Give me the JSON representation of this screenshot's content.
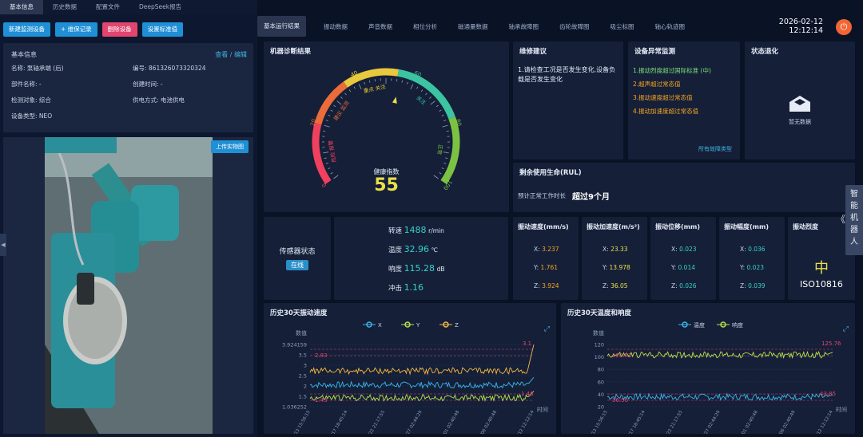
{
  "nav": {
    "tabs": [
      "基本信息",
      "历史数据",
      "配置文件",
      "DeepSeek报告"
    ]
  },
  "actions": {
    "new": "新建监测设备",
    "repair": "+ 维保记录",
    "delete": "删除设备",
    "standard": "设置标准值"
  },
  "info": {
    "title": "基本信息",
    "edit": "查看 / 编辑",
    "name": "名称:  泵轴承端 (后)",
    "code": "编号:  861326073320324",
    "part": "部件名称:  -",
    "created": "创建时间:  -",
    "object": "检测对象:  综合",
    "power": "供电方式:  电池供电",
    "type": "设备类型:  NEO"
  },
  "photo": {
    "upload": "上传实物图"
  },
  "subtabs": [
    "基本运行结果",
    "振动数据",
    "声音数据",
    "相位分析",
    "磁通量数据",
    "轴承故障图",
    "齿轮故障图",
    "吸尘标图",
    "轴心轨迹图"
  ],
  "datetime": {
    "date": "2026-02-12",
    "time": "12:12:14"
  },
  "diag": {
    "title": "机器诊断结果",
    "health_label": "健康指数",
    "health": 55,
    "health_fraction": 0.55,
    "ticks": [
      "0",
      "20",
      "40",
      "60",
      "80",
      "100"
    ],
    "zones": [
      "危险 报警",
      "建议 监测",
      "重点 关注",
      "关注",
      "正常"
    ]
  },
  "maint": {
    "title": "维修建议",
    "text": "1.请检查工况是否发生变化,设备负载是否发生变化"
  },
  "anomaly": {
    "title": "设备异常监测",
    "items": [
      "1.振动烈度超过国际标准 (中)",
      "2.超声超过常态值",
      "3.振动速度超过常态值",
      "4.振动加速度超过常态值"
    ],
    "link": "所有故障类型"
  },
  "trend": {
    "title": "状态退化",
    "empty": "暂无数据"
  },
  "rul": {
    "title": "剩余使用生命(RUL)",
    "label": "预计正常工作时长",
    "value": "超过9个月"
  },
  "sensor": {
    "label": "传感器状态",
    "status": "在线"
  },
  "metrics": [
    {
      "label": "转速",
      "value": "1488",
      "unit": "r/min"
    },
    {
      "label": "温度",
      "value": "32.96",
      "unit": "℃"
    },
    {
      "label": "响度",
      "value": "115.28",
      "unit": "dB"
    },
    {
      "label": "冲击",
      "value": "1.16",
      "unit": ""
    }
  ],
  "vib": {
    "velocity": {
      "title": "振动速度(mm/s)",
      "x": "3.237",
      "y": "1.761",
      "z": "3.924"
    },
    "accel": {
      "title": "振动加速度(m/s²)",
      "x": "23.33",
      "y": "13.978",
      "z": "36.05"
    },
    "disp": {
      "title": "振动位移(mm)",
      "x": "0.023",
      "y": "0.014",
      "z": "0.026"
    },
    "amp": {
      "title": "振动幅度(mm)",
      "x": "0.036",
      "y": "0.023",
      "z": "0.039"
    },
    "severity": {
      "title": "振动烈度",
      "level": "中",
      "standard": "ISO10816"
    },
    "axis_labels": [
      "X:",
      "Y:",
      "Z:"
    ]
  },
  "chart_data": [
    {
      "type": "line",
      "title": "历史30天振动速度",
      "ylabel": "数值",
      "xlabel": "时间",
      "yticks": [
        "3.924159",
        "3.5",
        "3",
        "2.5",
        "2",
        "1.5",
        "1.036252"
      ],
      "ylim": [
        1.036252,
        3.924159
      ],
      "x": [
        "2026/01/13 15:56:15",
        "2026/01/17 18:45:14",
        "2026/01/22 21:17:55",
        "2026/01/27 02:44:29",
        "2026/02/01 02:40:48",
        "2026/02/06 02:40:48",
        "2026/02/12 12:12:14"
      ],
      "series": [
        {
          "name": "X",
          "color": "#39b5e8",
          "base": 2.05,
          "end": 2.4
        },
        {
          "name": "Y",
          "color": "#b8e04a",
          "base": 1.45,
          "end": 1.76
        },
        {
          "name": "Z",
          "color": "#f5b942",
          "base": 2.7,
          "end": 3.92
        }
      ],
      "annotations": [
        "3.1",
        "2.83",
        "1.48",
        "1.43"
      ]
    },
    {
      "type": "line",
      "title": "历史30天温度和响度",
      "ylabel": "数值",
      "xlabel": "时间",
      "yticks": [
        "120",
        "100",
        "80",
        "60",
        "40",
        "20"
      ],
      "ylim": [
        10,
        130
      ],
      "x": [
        "2026/01/13 15:56:15",
        "2026/01/17 18:45:14",
        "2026/01/22 21:17:55",
        "2026/01/27 02:44:29",
        "2026/02/01 02:40:48",
        "2026/02/06 02:40:49",
        "2026/02/12 12:12:14"
      ],
      "series": [
        {
          "name": "温度",
          "color": "#39b5e8",
          "base": 29,
          "end": 33
        },
        {
          "name": "响度",
          "color": "#b8e04a",
          "base": 110,
          "end": 115
        }
      ],
      "annotations": [
        "125.76",
        "120.81",
        "43.85",
        "36.56"
      ]
    }
  ]
}
